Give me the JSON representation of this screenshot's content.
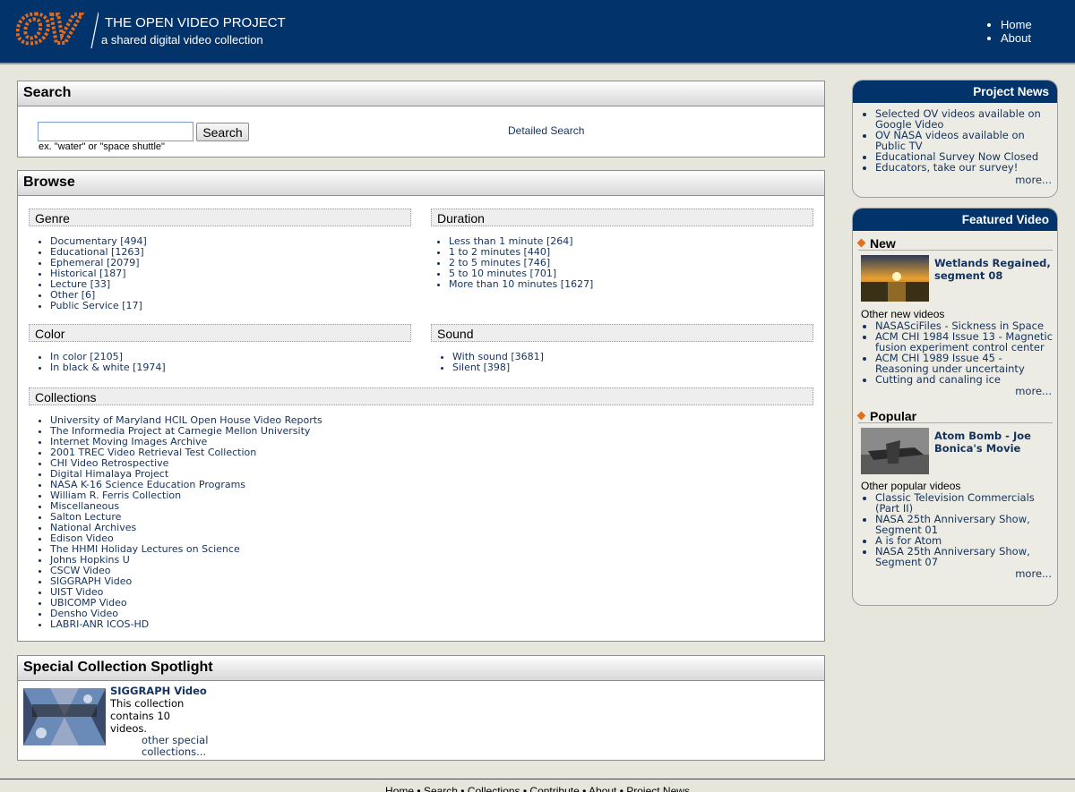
{
  "header": {
    "logo_text": "OV",
    "title": "THE OPEN VIDEO PROJECT",
    "tagline": "a shared digital video collection",
    "nav": [
      "Home",
      "About"
    ]
  },
  "search": {
    "heading": "Search",
    "input_value": "",
    "button_label": "Search",
    "hint": "ex. \"water\" or \"space shuttle\"",
    "detailed_link": "Detailed Search"
  },
  "browse": {
    "heading": "Browse",
    "genre": {
      "heading": "Genre",
      "items": [
        "Documentary   [494]",
        "Educational   [1263]",
        "Ephemeral   [2079]",
        "Historical   [187]",
        "Lecture   [33]",
        "Other   [6]",
        "Public Service   [17]"
      ]
    },
    "duration": {
      "heading": "Duration",
      "items": [
        "Less than 1 minute [264]",
        "1 to 2 minutes [440]",
        "2 to 5 minutes [746]",
        "5 to 10 minutes [701]",
        "More than 10 minutes [1627]"
      ]
    },
    "color": {
      "heading": "Color",
      "items": [
        "In color   [2105]",
        "In black & white   [1974]"
      ]
    },
    "sound": {
      "heading": "Sound",
      "items": [
        "With sound   [3681]",
        "Silent   [398]"
      ]
    },
    "collections": {
      "heading": "Collections",
      "items": [
        "University of Maryland HCIL Open House Video Reports",
        "The Informedia Project at Carnegie Mellon University",
        "Internet Moving Images Archive",
        "2001 TREC Video Retrieval Test Collection",
        "CHI Video Retrospective",
        "Digital Himalaya Project",
        "NASA K-16 Science Education Programs",
        "William R. Ferris Collection",
        "Miscellaneous",
        "Salton Lecture",
        "National Archives",
        "Edison Video",
        "The HHMI Holiday Lectures on Science",
        "Johns Hopkins U",
        "CSCW Video",
        "SIGGRAPH Video",
        "UIST Video",
        "UBICOMP Video",
        "Densho Video",
        "LABRI-ANR ICOS-HD"
      ]
    }
  },
  "spotlight": {
    "heading": "Special Collection Spotlight",
    "title": "SIGGRAPH Video",
    "description": "This collection contains 10 videos.",
    "more": "other special collections..."
  },
  "news": {
    "heading": "Project News",
    "items": [
      "Selected OV videos available on Google Video",
      "OV NASA videos available on Public TV",
      "Educational Survey Now Closed",
      "Educators, take our survey!"
    ],
    "more": "more..."
  },
  "featured": {
    "heading": "Featured Video",
    "new": {
      "heading": "New",
      "title": "Wetlands Regained, segment 08",
      "other_heading": "Other new videos",
      "items": [
        "NASASciFiles - Sickness in Space",
        "ACM CHI 1984 Issue 13 - Magnetic fusion experiment control center",
        "ACM CHI 1989 Issue 45 - Reasoning under uncertainty",
        "Cutting and canaling ice"
      ],
      "more": "more..."
    },
    "popular": {
      "heading": "Popular",
      "title": "Atom Bomb - Joe Bonica's Movie",
      "other_heading": "Other popular videos",
      "items": [
        "Classic Television Commercials (Part II)",
        "NASA 25th Anniversary Show, Segment 01",
        "A is for Atom",
        "NASA 25th Anniversary Show, Segment 07"
      ],
      "more": "more..."
    }
  },
  "footer": {
    "links": [
      "Home",
      "Search",
      "Collections",
      "Contribute",
      "About",
      "Project News"
    ]
  }
}
